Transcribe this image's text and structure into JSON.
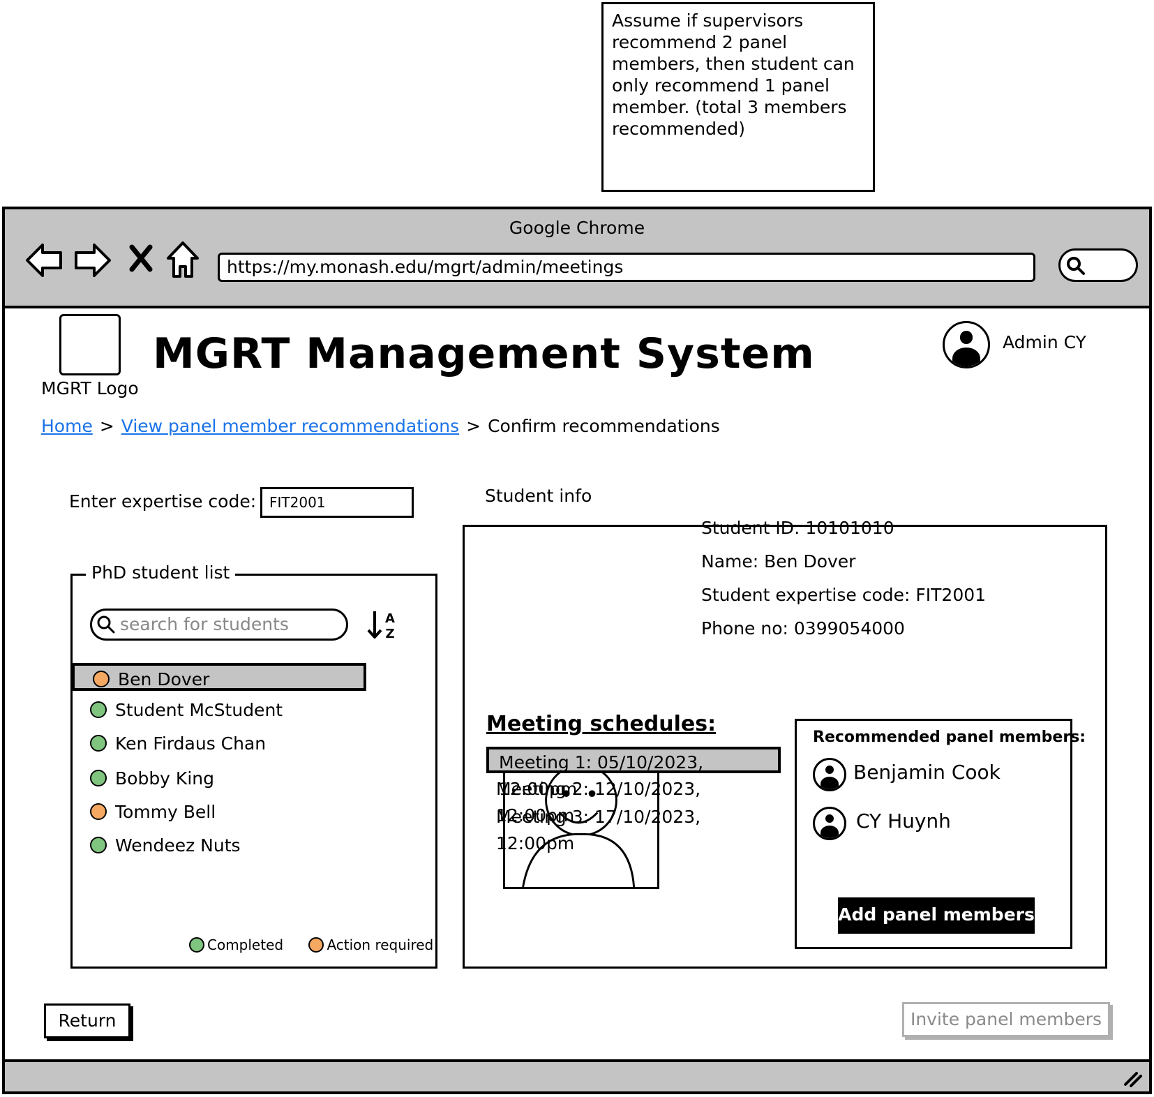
{
  "note": {
    "text": "Assume if supervisors recommend 2 panel members, then student can only recommend 1 panel member. (total 3 members recommended)"
  },
  "browser": {
    "title": "Google Chrome",
    "url": "https://my.monash.edu/mgrt/admin/meetings",
    "icons": [
      "back-icon",
      "forward-icon",
      "close-icon",
      "home-icon",
      "search-icon",
      "resize-handle-icon"
    ]
  },
  "header": {
    "logo_label": "MGRT Logo",
    "title": "MGRT Management System",
    "user_name": "Admin CY"
  },
  "breadcrumb": {
    "home": "Home",
    "recommendations": "View panel member recommendations",
    "current": "Confirm recommendations",
    "separator": ">"
  },
  "expertise": {
    "label": "Enter expertise code:",
    "value": "FIT2001"
  },
  "student_list": {
    "legend": "PhD student list",
    "search_placeholder": "search for students",
    "sort_icon": "sort-az-icon",
    "students": [
      {
        "name": "Ben Dover",
        "status": "action"
      },
      {
        "name": "Student McStudent",
        "status": "completed"
      },
      {
        "name": "Ken Firdaus Chan",
        "status": "completed"
      },
      {
        "name": "Bobby King",
        "status": "completed"
      },
      {
        "name": "Tommy Bell",
        "status": "action"
      },
      {
        "name": "Wendeez Nuts",
        "status": "completed"
      }
    ],
    "legend_completed": "Completed",
    "legend_action": "Action required",
    "colors": {
      "completed": "#7fc47f",
      "action": "#f5a862",
      "selected_bg": "#c4c4c4"
    }
  },
  "student_info": {
    "legend": "Student info",
    "student_id": "Student ID: 10101010",
    "name": "Name: Ben Dover",
    "expertise_code": "Student expertise code: FIT2001",
    "phone": "Phone no: 0399054000"
  },
  "meetings": {
    "title": "Meeting schedules:",
    "items": [
      "Meeting 1: 05/10/2023, 12:00pm",
      "Meeting 2: 12/10/2023, 12:00pm",
      "Meeting 3: 17/10/2023, 12:00pm"
    ]
  },
  "recommended": {
    "title": "Recommended panel members:",
    "members": [
      "Benjamin Cook",
      "CY Huynh"
    ],
    "add_button": "Add panel members"
  },
  "footer": {
    "return_button": "Return",
    "invite_button": "Invite panel members"
  }
}
